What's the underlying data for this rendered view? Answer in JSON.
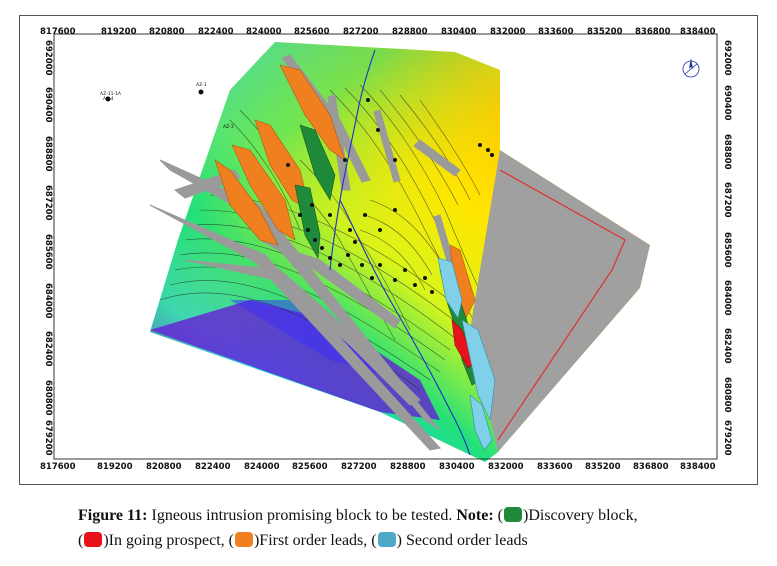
{
  "figure": {
    "x_ticks": [
      "817600",
      "819200",
      "820800",
      "822400",
      "824000",
      "825600",
      "827200",
      "828800",
      "830400",
      "832000",
      "833600",
      "835200",
      "836800",
      "838400"
    ],
    "y_ticks": [
      "692000",
      "690400",
      "688800",
      "687200",
      "685600",
      "684000",
      "682400",
      "680800",
      "679200"
    ],
    "colors": {
      "discovery": "#1e8a3a",
      "in_going": "#e8121b",
      "first_order": "#f07f1f",
      "second_order": "#4ea9c8",
      "fault": "#9a9a9a"
    },
    "well_labels": [
      "AZ-11-1A",
      "AZ-4",
      "AZ-1",
      "AZ-3"
    ]
  },
  "caption": {
    "figure_label": "Figure 11:",
    "text": " Igneous intrusion promising block to be tested. ",
    "note_label": "Note:",
    "open1": " (",
    "legend1": ")Discovery block,",
    "open2": "(",
    "legend2": ")In going prospect, (",
    "legend3": ")First order leads, (",
    "legend4": ") Second order leads"
  }
}
